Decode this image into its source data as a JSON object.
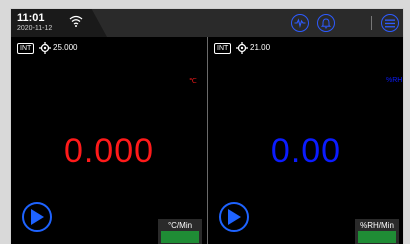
{
  "status_bar": {
    "time": "11:01",
    "date": "2020-11-12",
    "icons": [
      "wifi-icon",
      "waveform-icon",
      "alarm-bell-icon",
      "menu-icon"
    ],
    "accent": "#2d5bff"
  },
  "left_panel": {
    "mode_badge": "INT",
    "setpoint": "25.000",
    "unit": "℃",
    "value": "0.000",
    "value_color": "#ff1a1a",
    "rate_unit": "°C/Min"
  },
  "right_panel": {
    "mode_badge": "INT",
    "setpoint": "21.00",
    "unit": "%RH",
    "value": "0.00",
    "value_color": "#0b1cff",
    "rate_unit": "%RH/Min"
  }
}
